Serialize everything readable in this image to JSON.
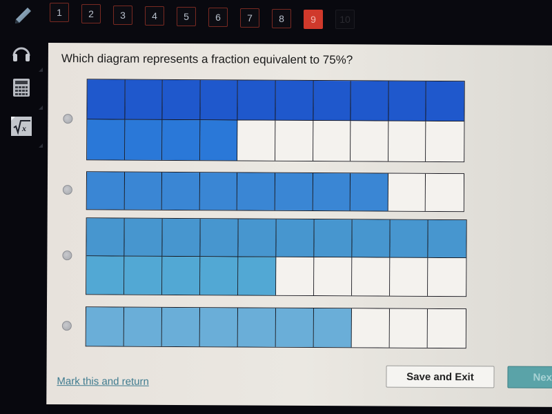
{
  "header": {
    "tools_icon": "pencil-icon",
    "question_nav": [
      {
        "label": "1",
        "state": "answered"
      },
      {
        "label": "2",
        "state": "answered"
      },
      {
        "label": "3",
        "state": "answered"
      },
      {
        "label": "4",
        "state": "answered"
      },
      {
        "label": "5",
        "state": "answered"
      },
      {
        "label": "6",
        "state": "answered"
      },
      {
        "label": "7",
        "state": "answered"
      },
      {
        "label": "8",
        "state": "answered"
      },
      {
        "label": "9",
        "state": "current"
      },
      {
        "label": "10",
        "state": "disabled"
      }
    ]
  },
  "sidebar": {
    "tools": [
      {
        "name": "headphones-icon",
        "label": "Audio"
      },
      {
        "name": "calculator-icon",
        "label": "Calculator"
      },
      {
        "name": "formula-icon",
        "label": "√x"
      }
    ]
  },
  "question": {
    "text": "Which diagram represents a fraction equivalent to 75%?",
    "options": [
      {
        "id": "A",
        "rows": 2,
        "cols": 10,
        "shaded": 14,
        "color": "#1f58cc",
        "color2": "#2a78d8",
        "selected": false
      },
      {
        "id": "B",
        "rows": 1,
        "cols": 10,
        "shaded": 8,
        "color": "#3a86d4",
        "color2": "#3a86d4",
        "selected": false
      },
      {
        "id": "C",
        "rows": 2,
        "cols": 10,
        "shaded": 15,
        "color": "#4796cf",
        "color2": "#52a8d4",
        "selected": false
      },
      {
        "id": "D",
        "rows": 1,
        "cols": 10,
        "shaded": 7,
        "color": "#6aaed8",
        "color2": "#6aaed8",
        "selected": false
      }
    ]
  },
  "footer": {
    "mark_link": "Mark this and return",
    "save_label": "Save and Exit",
    "next_label": "Next"
  },
  "colors": {
    "current_question": "#d0392b",
    "next_button": "#5aa3a8",
    "link": "#3f7b8f"
  }
}
